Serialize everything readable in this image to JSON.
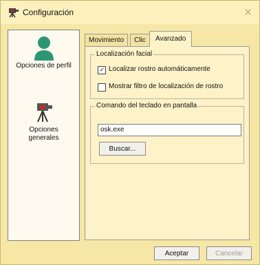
{
  "window": {
    "title": "Configuración",
    "close_glyph": "✕",
    "icon": "camera-tripod-icon"
  },
  "sidebar": {
    "items": [
      {
        "label": "Opciones de perfil",
        "icon": "user-profile-icon"
      },
      {
        "label": "Opciones\ngenerales",
        "icon": "camera-tripod-icon"
      }
    ]
  },
  "tabs": [
    "Movimiento",
    "Clic",
    "Avanzado"
  ],
  "panel": {
    "face_group": {
      "legend": "Localización facial",
      "options": [
        {
          "label": "Localizar rostro automáticamente",
          "checked": true
        },
        {
          "label": "Mostrar filtro de localización de rostro",
          "checked": false
        }
      ]
    },
    "keyboard_group": {
      "legend": "Comando del teclado en pantalla",
      "value": "osk.exe",
      "browse_label": "Buscar..."
    }
  },
  "footer": {
    "accept_label": "Aceptar",
    "cancel_label": "Cancelar"
  },
  "colors": {
    "background": "#fbe79e",
    "panel": "#fdf2c8",
    "profile_icon": "#2f9577",
    "camera_accent": "#d32424"
  }
}
